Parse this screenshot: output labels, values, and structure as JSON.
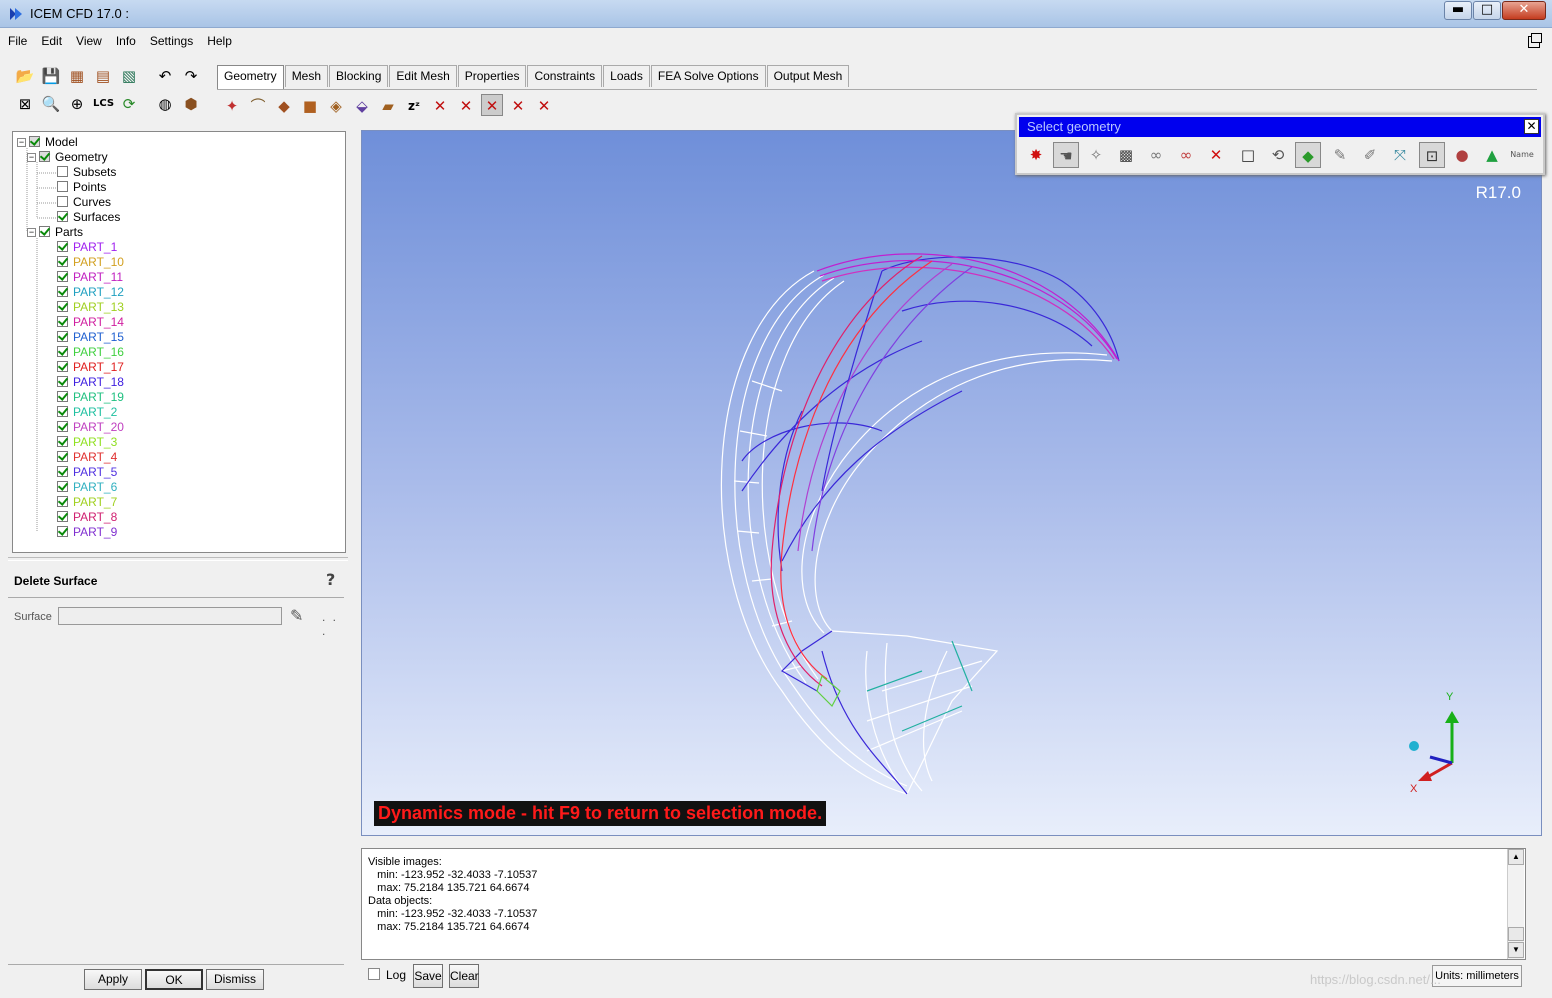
{
  "window": {
    "title": "ICEM CFD 17.0 :",
    "minimize": "▬",
    "maximize": "□",
    "close": "✕"
  },
  "menu": [
    "File",
    "Edit",
    "View",
    "Info",
    "Settings",
    "Help"
  ],
  "tabs": [
    "Geometry",
    "Mesh",
    "Blocking",
    "Edit Mesh",
    "Properties",
    "Constraints",
    "Loads",
    "FEA Solve Options",
    "Output Mesh"
  ],
  "tree": {
    "model": "Model",
    "geometry": "Geometry",
    "geometry_children": [
      {
        "label": "Subsets",
        "checked": false
      },
      {
        "label": "Points",
        "checked": false
      },
      {
        "label": "Curves",
        "checked": false
      },
      {
        "label": "Surfaces",
        "checked": true
      }
    ],
    "parts_label": "Parts",
    "parts": [
      {
        "label": "PART_1",
        "color": "#a020f0"
      },
      {
        "label": "PART_10",
        "color": "#d2a020"
      },
      {
        "label": "PART_11",
        "color": "#c020c0"
      },
      {
        "label": "PART_12",
        "color": "#20a0c0"
      },
      {
        "label": "PART_13",
        "color": "#a0d020"
      },
      {
        "label": "PART_14",
        "color": "#d020a0"
      },
      {
        "label": "PART_15",
        "color": "#2060d0"
      },
      {
        "label": "PART_16",
        "color": "#40d040"
      },
      {
        "label": "PART_17",
        "color": "#e02020"
      },
      {
        "label": "PART_18",
        "color": "#4020e0"
      },
      {
        "label": "PART_19",
        "color": "#20c080"
      },
      {
        "label": "PART_2",
        "color": "#20c0a0"
      },
      {
        "label": "PART_20",
        "color": "#c040c0"
      },
      {
        "label": "PART_3",
        "color": "#90e020"
      },
      {
        "label": "PART_4",
        "color": "#e03030"
      },
      {
        "label": "PART_5",
        "color": "#5030e0"
      },
      {
        "label": "PART_6",
        "color": "#30b0c0"
      },
      {
        "label": "PART_7",
        "color": "#a0d020"
      },
      {
        "label": "PART_8",
        "color": "#d02070"
      },
      {
        "label": "PART_9",
        "color": "#8030d0"
      }
    ]
  },
  "delete_panel": {
    "title": "Delete Surface",
    "surface_label": "Surface",
    "surface_value": "",
    "dots": ". . .",
    "apply": "Apply",
    "ok": "OK",
    "dismiss": "Dismiss"
  },
  "select_geometry": {
    "title": "Select geometry",
    "name_button": "Name"
  },
  "viewport": {
    "version": "R17.0",
    "message": "Dynamics mode - hit F9 to return to selection mode.",
    "axis_x": "X",
    "axis_y": "Y"
  },
  "console": {
    "lines": [
      "Visible images:",
      "   min: -123.952 -32.4033 -7.10537",
      "   max: 75.2184 135.721 64.6674",
      "Data objects:",
      "   min: -123.952 -32.4033 -7.10537",
      "   max: 75.2184 135.721 64.6674"
    ],
    "log_label": "Log",
    "save": "Save",
    "clear": "Clear",
    "units": "Units: millimeters"
  },
  "watermark": "https://blog.csdn.net/..."
}
